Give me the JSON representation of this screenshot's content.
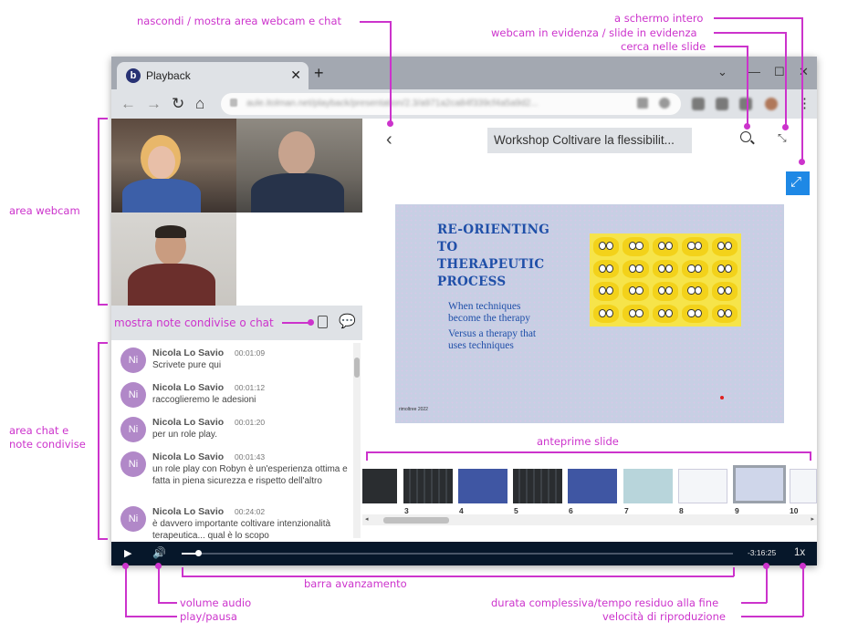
{
  "annotations": {
    "toggle_webcam_chat": "nascondi / mostra area webcam e chat",
    "fullscreen": "a schermo intero",
    "swap_webcam_slide": "webcam in evidenza / slide in evidenza",
    "search_slides": "cerca nelle slide",
    "webcam_area": "area webcam",
    "show_notes_or_chat": "mostra note condivise o chat",
    "chat_area_1": "area chat e",
    "chat_area_2": "note condivise",
    "slide_thumbnails": "anteprime slide",
    "progress_bar": "barra avanzamento",
    "volume": "volume audio",
    "play_pause": "play/pausa",
    "duration": "durata complessiva/tempo residuo alla fine",
    "playback_speed": "velocità di riproduzione"
  },
  "browser": {
    "tab_title": "Playback",
    "tab_favicon": "b",
    "url": "aule.itolman.net/playback/presentation/2.3/a971a2ca84f339cf4a5a9d2..."
  },
  "presentation": {
    "title": "Workshop Coltivare la flessibilit...",
    "slide": {
      "title_lines": [
        "RE-ORIENTING",
        "TO",
        "THERAPEUTIC",
        "PROCESS"
      ],
      "sub_lines_1": [
        "When techniques",
        "become the therapy"
      ],
      "sub_lines_2": [
        "Versus a therapy that",
        "uses techniques"
      ],
      "footer": "rimoltree 2022"
    },
    "thumbnails": [
      "",
      "3",
      "4",
      "5",
      "6",
      "7",
      "8",
      "9",
      "10"
    ],
    "current_slide": "9"
  },
  "chat": [
    {
      "initials": "Ni",
      "name": "Nicola Lo Savio",
      "time": "00:01:09",
      "text": "Scrivete pure qui"
    },
    {
      "initials": "Ni",
      "name": "Nicola Lo Savio",
      "time": "00:01:12",
      "text": "raccoglieremo le adesioni"
    },
    {
      "initials": "Ni",
      "name": "Nicola Lo Savio",
      "time": "00:01:20",
      "text": "per un role play."
    },
    {
      "initials": "Ni",
      "name": "Nicola Lo Savio",
      "time": "00:01:43",
      "text": "un role play con Robyn è un'esperienza ottima e fatta in piena sicurezza e rispetto dell'altro"
    },
    {
      "initials": "Ni",
      "name": "Nicola Lo Savio",
      "time": "00:24:02",
      "text": "è davvero importante coltivare intenzionalità terapeutica... qual è  lo scopo"
    }
  ],
  "player": {
    "time_remaining": "-3:16:25",
    "speed": "1x",
    "progress_fraction": 0.03
  },
  "colors": {
    "annotation": "#cc33cc",
    "controls_bg": "#06172a",
    "accent": "#1e88e5",
    "avatar": "#b188c8"
  }
}
